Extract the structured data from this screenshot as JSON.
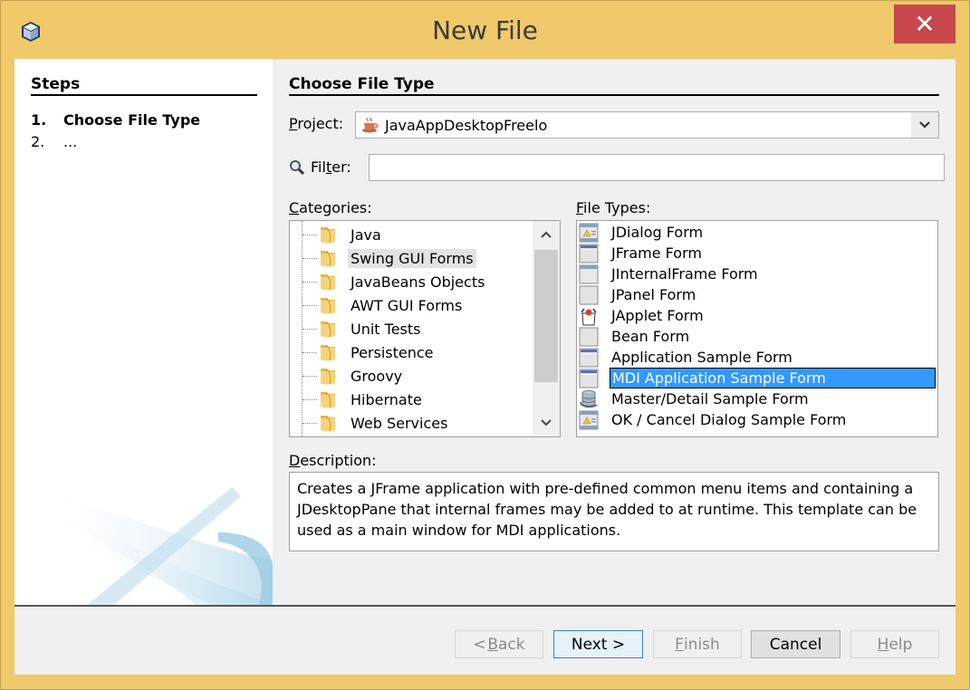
{
  "window": {
    "title": "New File",
    "close_label": "✕"
  },
  "steps": {
    "heading": "Steps",
    "items": [
      {
        "num": "1.",
        "label": "Choose File Type",
        "current": true
      },
      {
        "num": "2.",
        "label": "...",
        "current": false
      }
    ]
  },
  "main": {
    "heading": "Choose File Type",
    "project": {
      "label_mnemonic": "P",
      "label_rest": "roject:",
      "value": "JavaAppDesktopFreelo"
    },
    "filter": {
      "label_pre": "Fil",
      "label_mnemonic": "t",
      "label_post": "er:",
      "value": "",
      "placeholder": ""
    },
    "categories": {
      "label_mnemonic": "C",
      "label_rest": "ategories:",
      "items": [
        "Java",
        "Swing GUI Forms",
        "JavaBeans Objects",
        "AWT GUI Forms",
        "Unit Tests",
        "Persistence",
        "Groovy",
        "Hibernate",
        "Web Services"
      ],
      "selected": "Swing GUI Forms"
    },
    "file_types": {
      "label_mnemonic": "F",
      "label_rest": "ile Types:",
      "items": [
        {
          "label": "JDialog Form",
          "icon": "dialog-form-icon"
        },
        {
          "label": "JFrame Form",
          "icon": "frame-form-icon"
        },
        {
          "label": "JInternalFrame Form",
          "icon": "internal-frame-form-icon"
        },
        {
          "label": "JPanel Form",
          "icon": "panel-form-icon"
        },
        {
          "label": "JApplet Form",
          "icon": "applet-form-icon"
        },
        {
          "label": "Bean Form",
          "icon": "bean-form-icon"
        },
        {
          "label": "Application Sample Form",
          "icon": "frame-form-icon"
        },
        {
          "label": "MDI Application Sample Form",
          "icon": "frame-form-icon"
        },
        {
          "label": "Master/Detail Sample Form",
          "icon": "database-form-icon"
        },
        {
          "label": "OK / Cancel Dialog Sample Form",
          "icon": "dialog-form-icon"
        }
      ],
      "selected": "MDI Application Sample Form"
    },
    "description": {
      "label_mnemonic": "D",
      "label_rest": "escription:",
      "text": "Creates a JFrame application with pre-defined common menu items and containing a JDesktopPane that internal frames may be added to at runtime. This template can be used as a main window for MDI applications."
    }
  },
  "buttons": {
    "back": {
      "pre": "< ",
      "mnemonic": "B",
      "rest": "ack",
      "enabled": false
    },
    "next": {
      "label": "Next >",
      "enabled": true
    },
    "finish": {
      "mnemonic": "F",
      "rest": "inish",
      "enabled": false
    },
    "cancel": {
      "label": "Cancel",
      "enabled": true
    },
    "help": {
      "mnemonic": "H",
      "rest": "elp",
      "enabled": false
    }
  },
  "colors": {
    "title_bar": "#f0c96a",
    "close_button": "#c7474b",
    "selection": "#3399ff"
  }
}
